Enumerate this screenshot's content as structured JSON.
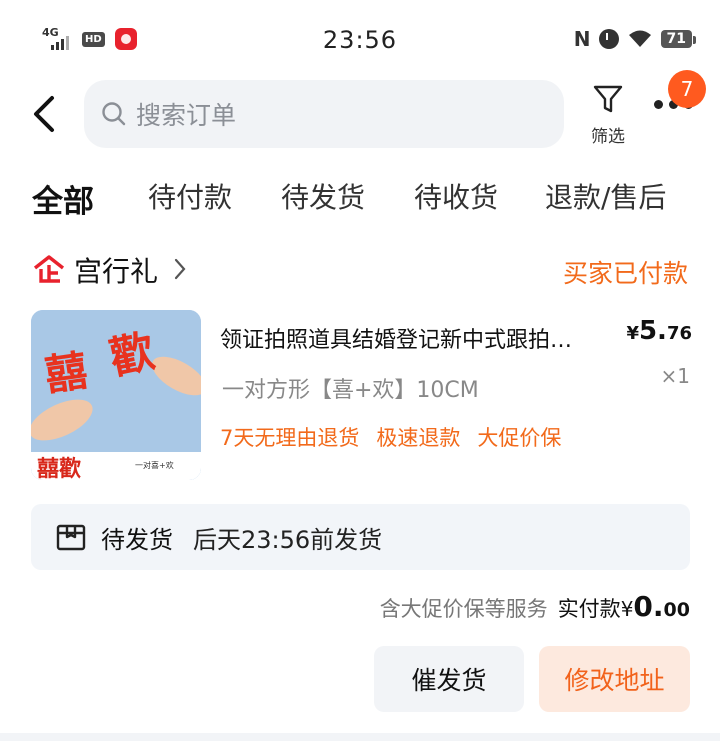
{
  "status_bar": {
    "network": "4G",
    "hd": "HD",
    "time": "23:56",
    "nfc": "N",
    "battery": "71"
  },
  "header": {
    "search_placeholder": "搜索订单",
    "filter_label": "筛选",
    "more_badge": "7"
  },
  "tabs": [
    {
      "label": "全部",
      "active": true
    },
    {
      "label": "待付款"
    },
    {
      "label": "待发货"
    },
    {
      "label": "待收货"
    },
    {
      "label": "退款/售后"
    }
  ],
  "order": {
    "shop_name": "宫行礼",
    "status": "买家已付款",
    "product": {
      "name": "领证拍照道具结婚登记新中式跟拍…",
      "price_currency": "¥",
      "price_int": "5.",
      "price_dec": "76",
      "quantity": "×1",
      "sku": "一对方形【喜+欢】10CM",
      "tags": [
        "7天无理由退货",
        "极速退款",
        "大促价保"
      ],
      "thumb_text_main": "囍歡",
      "thumb_text_sub": "一对喜+欢"
    },
    "shipping": {
      "status": "待发货",
      "eta": "后天23:56前发货"
    },
    "total": {
      "service_note": "含大促价保等服务",
      "label": "实付款",
      "currency": "¥",
      "int": "0.",
      "dec": "00"
    },
    "actions": {
      "urge_label": "催发货",
      "change_address_label": "修改地址"
    }
  },
  "colors": {
    "accent_orange": "#f26a1b",
    "badge": "#ff5a1f",
    "shop_icon": "#e8222d"
  }
}
